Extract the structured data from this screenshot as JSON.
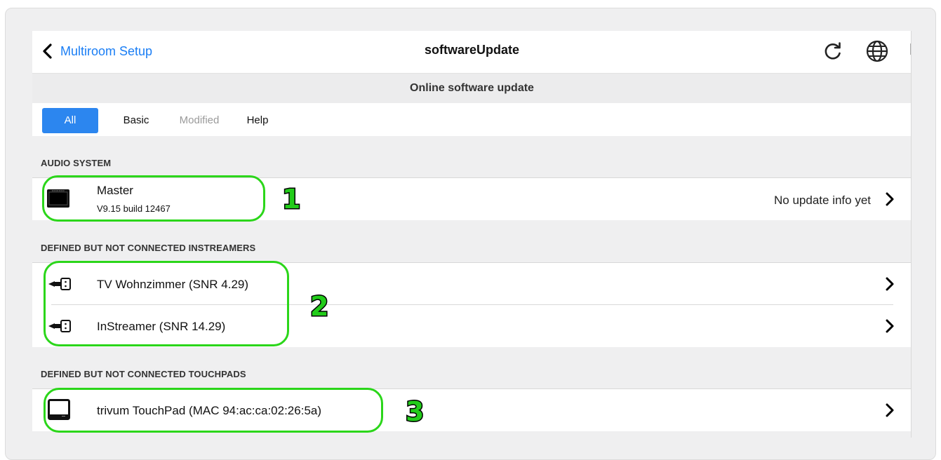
{
  "header": {
    "back_label": "Multiroom Setup",
    "title": "softwareUpdate",
    "icons": [
      "refresh-icon",
      "globe-icon"
    ]
  },
  "subheader": {
    "title": "Online software update"
  },
  "tabs": [
    {
      "label": "All",
      "state": "active"
    },
    {
      "label": "Basic",
      "state": "normal"
    },
    {
      "label": "Modified",
      "state": "disabled"
    },
    {
      "label": "Help",
      "state": "normal"
    }
  ],
  "sections": {
    "audio_system": {
      "label": "AUDIO SYSTEM",
      "items": [
        {
          "name": "Master",
          "version": "V9.15 build 12467",
          "status": "No update info yet",
          "icon": "master-device-icon"
        }
      ]
    },
    "instreamers": {
      "label": "DEFINED BUT NOT CONNECTED INSTREAMERS",
      "items": [
        {
          "name": "TV Wohnzimmer (SNR 4.29)",
          "icon": "instreamer-icon"
        },
        {
          "name": "InStreamer (SNR 14.29)",
          "icon": "instreamer-icon"
        }
      ]
    },
    "touchpads": {
      "label": "DEFINED BUT NOT CONNECTED TOUCHPADS",
      "items": [
        {
          "name": "trivum TouchPad (MAC 94:ac:ca:02:26:5a)",
          "icon": "touchpad-icon"
        }
      ]
    }
  },
  "annotations": {
    "markers": [
      "1",
      "2",
      "3"
    ],
    "highlight_color": "#2bd61a"
  },
  "colors": {
    "accent": "#1a7ef5",
    "tab_active": "#2c86ef",
    "background": "#efeff0"
  }
}
